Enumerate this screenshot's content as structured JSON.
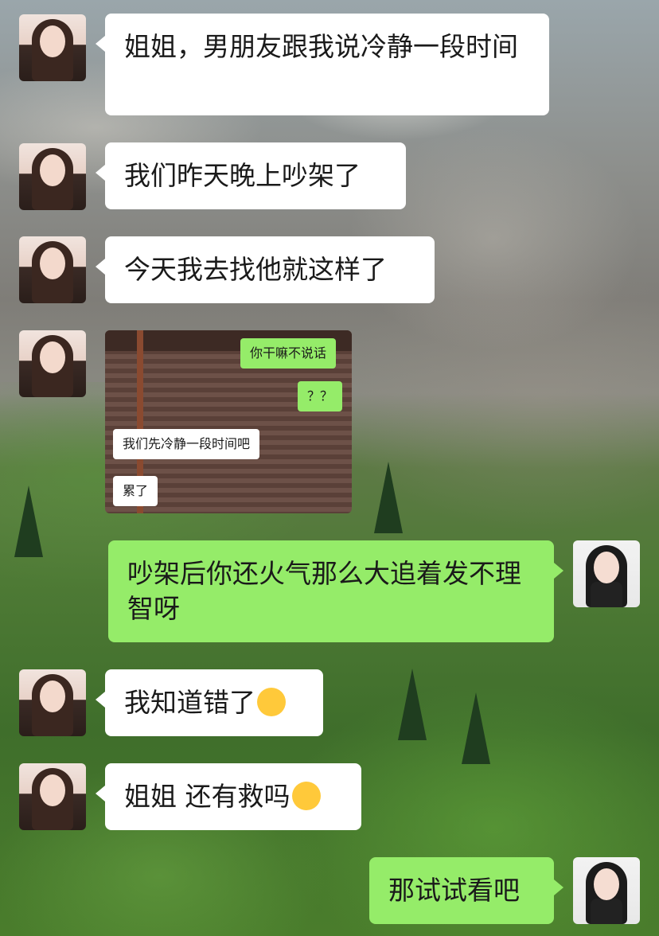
{
  "chat": {
    "messages": [
      {
        "side": "in",
        "text": "姐姐，男朋友跟我说冷静一段时间"
      },
      {
        "side": "in",
        "text": "我们昨天晚上吵架了"
      },
      {
        "side": "in",
        "text": "今天我去找他就这样了"
      },
      {
        "side": "in",
        "type": "image"
      },
      {
        "side": "out",
        "text": "吵架后你还火气那么大追着发不理智呀"
      },
      {
        "side": "in",
        "text": "我知道错了",
        "emoji": "crying-face"
      },
      {
        "side": "in",
        "text": "姐姐 还有救吗",
        "emoji": "pleading-face"
      },
      {
        "side": "out",
        "text": "那试试看吧"
      }
    ],
    "screenshot": {
      "messages": [
        {
          "side": "out",
          "text": "你干嘛不说话"
        },
        {
          "side": "out",
          "text": "？？"
        },
        {
          "side": "in",
          "text": "我们先冷静一段时间吧"
        },
        {
          "side": "in",
          "text": "累了"
        }
      ]
    }
  },
  "colors": {
    "incoming_bubble": "#ffffff",
    "outgoing_bubble": "#95ec69"
  }
}
